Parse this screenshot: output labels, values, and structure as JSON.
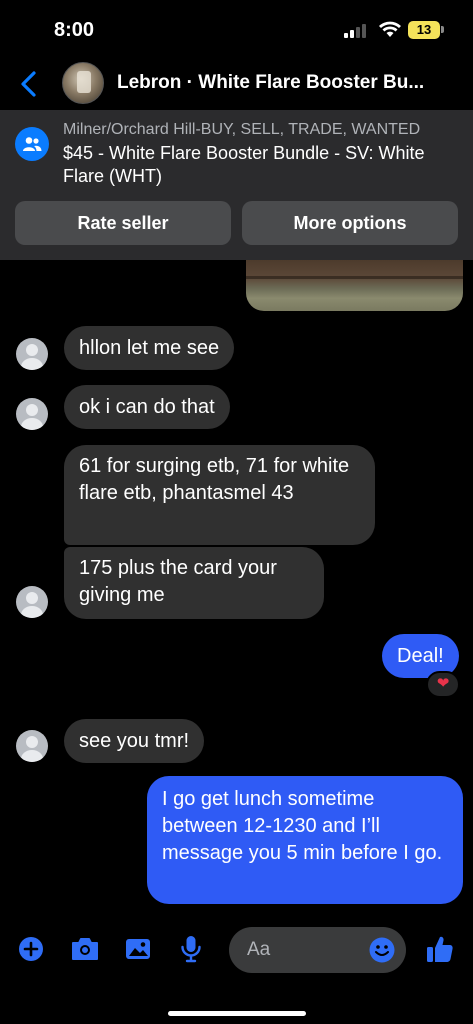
{
  "status_bar": {
    "time": "8:00",
    "battery": "13",
    "battery_color": "#f5e35a"
  },
  "header": {
    "title": "Lebron · White Flare Booster Bu...",
    "back_icon": "chevron-left-icon",
    "accent": "#0a7cff"
  },
  "listing": {
    "group": "Milner/Orchard Hill-BUY, SELL, TRADE, WANTED",
    "item": "$45 - White Flare Booster Bundle - SV: White Flare (WHT)",
    "rate_seller_label": "Rate seller",
    "more_options_label": "More options"
  },
  "messages": [
    {
      "from": "them",
      "text": "hllon let me see"
    },
    {
      "from": "them",
      "text": "ok i can do that"
    },
    {
      "from": "them",
      "text": "61 for surging etb, 71 for white flare etb, phantasmel 43"
    },
    {
      "from": "them",
      "text": "175 plus the card your giving me"
    },
    {
      "from": "me",
      "text": "Deal!",
      "reaction": "❤"
    },
    {
      "from": "them",
      "text": "see you tmr!"
    },
    {
      "from": "me",
      "text": "I go get lunch sometime between 12-1230 and I’ll message you 5 min before I go."
    }
  ],
  "composer": {
    "placeholder": "Aa",
    "icons": [
      "plus-icon",
      "camera-icon",
      "image-icon",
      "microphone-icon",
      "emoji-icon",
      "thumbs-up-icon"
    ]
  },
  "colors": {
    "outgoing_bubble": "#2f5bf5",
    "incoming_bubble": "#303030",
    "background": "#000000"
  }
}
